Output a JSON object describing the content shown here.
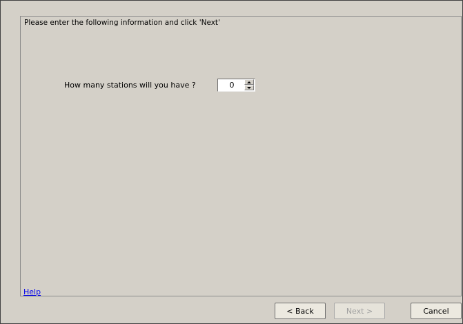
{
  "instructions": "Please enter the following information and click 'Next'",
  "stations": {
    "label": "How many stations will you have ?",
    "value": "0"
  },
  "help_link": "Help",
  "buttons": {
    "back": "< Back",
    "next": "Next >",
    "cancel": "Cancel"
  },
  "icons": {
    "spin_up": "triangle-up",
    "spin_down": "triangle-down"
  },
  "states": {
    "next_enabled": false
  }
}
